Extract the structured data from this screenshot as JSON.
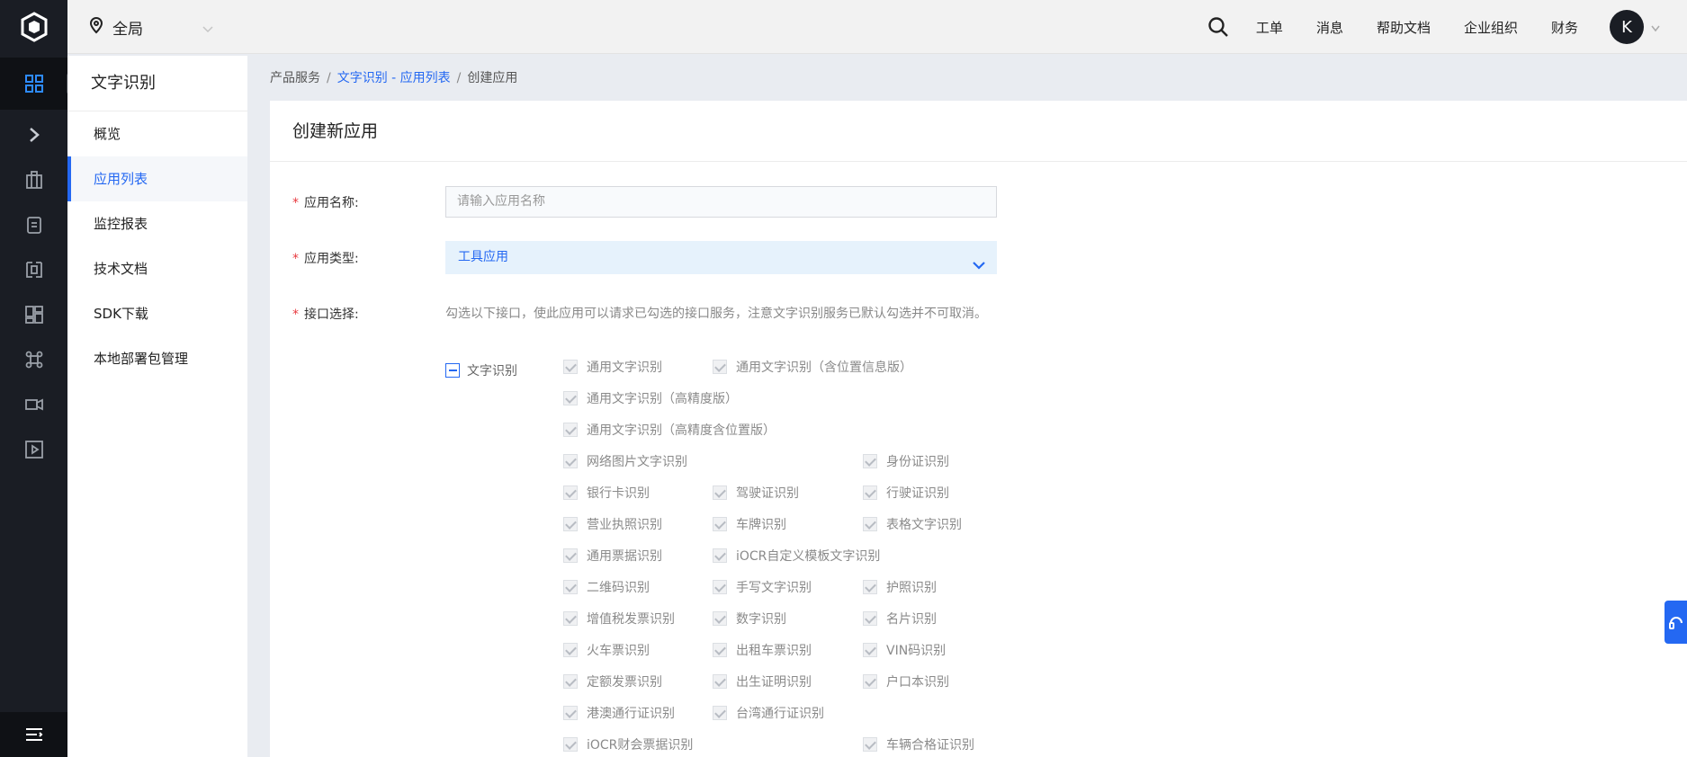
{
  "topbar": {
    "region": "全局",
    "nav": [
      "工单",
      "消息",
      "帮助文档",
      "企业组织",
      "财务"
    ],
    "avatar_letter": "K"
  },
  "sidebar": {
    "title": "文字识别",
    "items": [
      {
        "label": "概览",
        "active": false
      },
      {
        "label": "应用列表",
        "active": true
      },
      {
        "label": "监控报表",
        "active": false
      },
      {
        "label": "技术文档",
        "active": false
      },
      {
        "label": "SDK下载",
        "active": false
      },
      {
        "label": "本地部署包管理",
        "active": false
      }
    ]
  },
  "breadcrumb": {
    "root": "产品服务",
    "link": "文字识别 - 应用列表",
    "current": "创建应用"
  },
  "form": {
    "title": "创建新应用",
    "name_label": "应用名称:",
    "name_placeholder": "请输入应用名称",
    "type_label": "应用类型:",
    "type_value": "工具应用",
    "api_label": "接口选择:",
    "api_hint": "勾选以下接口，使此应用可以请求已勾选的接口服务，注意文字识别服务已默认勾选并不可取消。",
    "group_label": "文字识别",
    "options": [
      "通用文字识别",
      "通用文字识别（含位置信息版）",
      "通用文字识别（高精度版）",
      "通用文字识别（高精度含位置版）",
      "网络图片文字识别",
      "身份证识别",
      "银行卡识别",
      "驾驶证识别",
      "行驶证识别",
      "营业执照识别",
      "车牌识别",
      "表格文字识别",
      "通用票据识别",
      "iOCR自定义模板文字识别",
      "二维码识别",
      "手写文字识别",
      "护照识别",
      "增值税发票识别",
      "数字识别",
      "名片识别",
      "火车票识别",
      "出租车票识别",
      "VIN码识别",
      "定额发票识别",
      "出生证明识别",
      "户口本识别",
      "港澳通行证识别",
      "台湾通行证识别",
      "iOCR财会票据识别",
      "车辆合格证识别"
    ]
  },
  "colors": {
    "accent": "#2468f2",
    "rail": "#1a1d24",
    "required": "#e8393f"
  }
}
